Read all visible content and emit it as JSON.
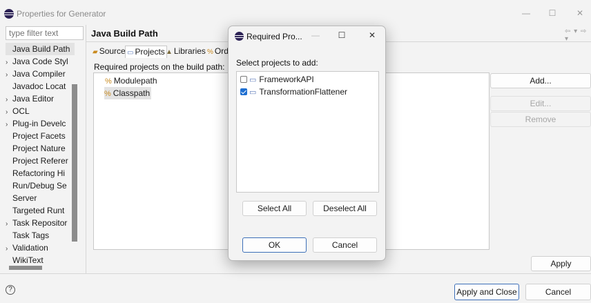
{
  "window": {
    "title": "Properties for Generator"
  },
  "filter": {
    "placeholder": "type filter text"
  },
  "tree": {
    "items": [
      {
        "label": "Java Build Path",
        "expandable": false,
        "selected": true
      },
      {
        "label": "Java Code Styl",
        "expandable": true
      },
      {
        "label": "Java Compiler",
        "expandable": true
      },
      {
        "label": "Javadoc Locat",
        "expandable": false
      },
      {
        "label": "Java Editor",
        "expandable": true
      },
      {
        "label": "OCL",
        "expandable": true
      },
      {
        "label": "Plug-in Develc",
        "expandable": true
      },
      {
        "label": "Project Facets",
        "expandable": false
      },
      {
        "label": "Project Nature",
        "expandable": false
      },
      {
        "label": "Project Referer",
        "expandable": false
      },
      {
        "label": "Refactoring Hi",
        "expandable": false
      },
      {
        "label": "Run/Debug Se",
        "expandable": false
      },
      {
        "label": "Server",
        "expandable": false
      },
      {
        "label": "Targeted Runt",
        "expandable": false
      },
      {
        "label": "Task Repositor",
        "expandable": true
      },
      {
        "label": "Task Tags",
        "expandable": false
      },
      {
        "label": "Validation",
        "expandable": true
      },
      {
        "label": "WikiText",
        "expandable": false
      }
    ]
  },
  "page": {
    "title": "Java Build Path",
    "tabs": [
      {
        "label": "Source",
        "icon": "source-folder-icon",
        "active": false
      },
      {
        "label": "Projects",
        "icon": "project-icon",
        "active": true
      },
      {
        "label": "Libraries",
        "icon": "library-icon",
        "active": false
      },
      {
        "label": "Ord",
        "icon": "order-icon",
        "active": false
      }
    ],
    "required_label": "Required projects on the build path:",
    "build_path_items": [
      {
        "label": "Modulepath",
        "icon": "path-icon",
        "selected": false
      },
      {
        "label": "Classpath",
        "icon": "path-icon",
        "selected": true
      }
    ],
    "buttons": {
      "add": "Add...",
      "edit": "Edit...",
      "remove": "Remove"
    },
    "apply": "Apply"
  },
  "footer": {
    "help": "?",
    "apply_and_close": "Apply and Close",
    "cancel": "Cancel"
  },
  "dialog": {
    "title": "Required Pro...",
    "label": "Select projects to add:",
    "projects": [
      {
        "label": "FrameworkAPI",
        "checked": false
      },
      {
        "label": "TransformationFlattener",
        "checked": true
      }
    ],
    "select_all": "Select All",
    "deselect_all": "Deselect All",
    "ok": "OK",
    "cancel": "Cancel"
  },
  "colors": {
    "accent": "#1f6fd1",
    "default_button_border": "#3c6eb8",
    "window_bg": "#f3f3f3"
  }
}
